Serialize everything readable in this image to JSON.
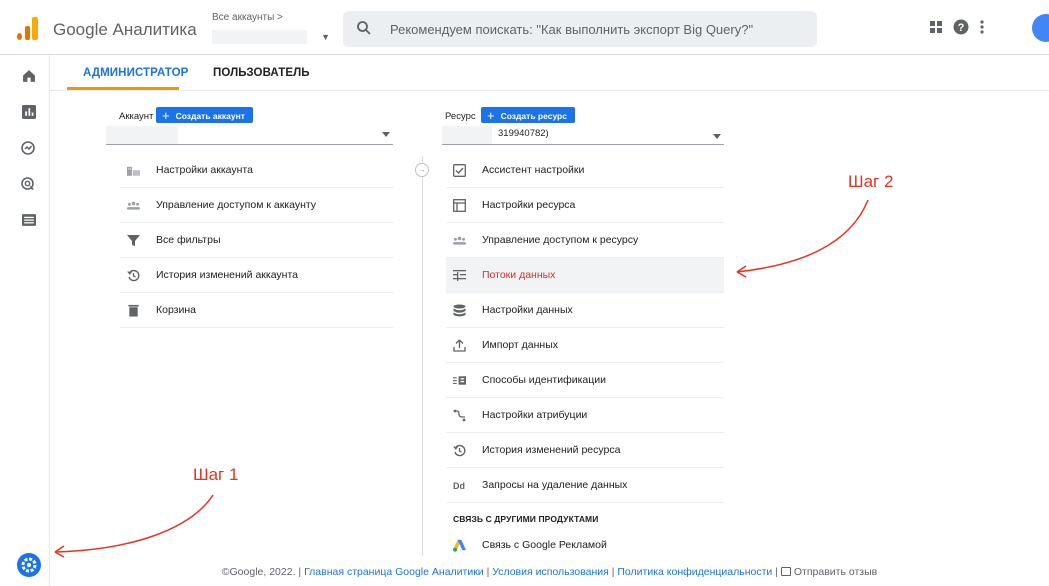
{
  "app": {
    "title": "Google Аналитика"
  },
  "account_picker": {
    "breadcrumb": "Все аккаунты >"
  },
  "search": {
    "placeholder": "Рекомендуем поискать: \"Как выполнить экспорт Big Query?\""
  },
  "tabs": [
    {
      "label": "АДМИНИСТРАТОР",
      "active": true
    },
    {
      "label": "ПОЛЬЗОВАТЕЛЬ",
      "active": false
    }
  ],
  "account_column": {
    "label": "Аккаунт",
    "create_button": "Создать аккаунт",
    "items": [
      {
        "label": "Настройки аккаунта",
        "icon": "account-settings-icon"
      },
      {
        "label": "Управление доступом к аккаунту",
        "icon": "people-icon"
      },
      {
        "label": "Все фильтры",
        "icon": "filter-icon"
      },
      {
        "label": "История изменений аккаунта",
        "icon": "history-icon"
      },
      {
        "label": "Корзина",
        "icon": "trash-icon"
      }
    ]
  },
  "property_column": {
    "label": "Ресурс",
    "create_button": "Создать ресурс",
    "selected_value": "319940782)",
    "items": [
      {
        "label": "Ассистент настройки",
        "icon": "checklist-icon"
      },
      {
        "label": "Настройки ресурса",
        "icon": "property-settings-icon"
      },
      {
        "label": "Управление доступом к ресурсу",
        "icon": "people-icon"
      },
      {
        "label": "Потоки данных",
        "icon": "data-streams-icon",
        "active": true
      },
      {
        "label": "Настройки данных",
        "icon": "database-icon"
      },
      {
        "label": "Импорт данных",
        "icon": "upload-icon"
      },
      {
        "label": "Способы идентификации",
        "icon": "identity-icon"
      },
      {
        "label": "Настройки атрибуции",
        "icon": "attribution-icon"
      },
      {
        "label": "История изменений ресурса",
        "icon": "history-icon"
      },
      {
        "label": "Запросы на удаление данных",
        "icon": "dd-icon"
      }
    ],
    "section_header": "СВЯЗЬ С ДРУГИМИ ПРОДУКТАМИ",
    "links": [
      {
        "label": "Связь с Google Рекламой",
        "icon": "google-ads-icon"
      }
    ]
  },
  "footer": {
    "copyright": "©Google, 2022. |",
    "link_home": "Главная страница Google Аналитики",
    "sep1": "|",
    "link_terms": "Условия использования",
    "sep2": "|",
    "link_privacy": "Политика конфиденциальности",
    "sep3": "|",
    "feedback": "Отправить отзыв"
  },
  "annotations": {
    "step1": "Шаг 1",
    "step2": "Шаг 2"
  },
  "colors": {
    "accent": "#1a73e8",
    "tab_indicator": "#f29900",
    "annotation": "#e8311f",
    "active_item": "#d93025"
  }
}
